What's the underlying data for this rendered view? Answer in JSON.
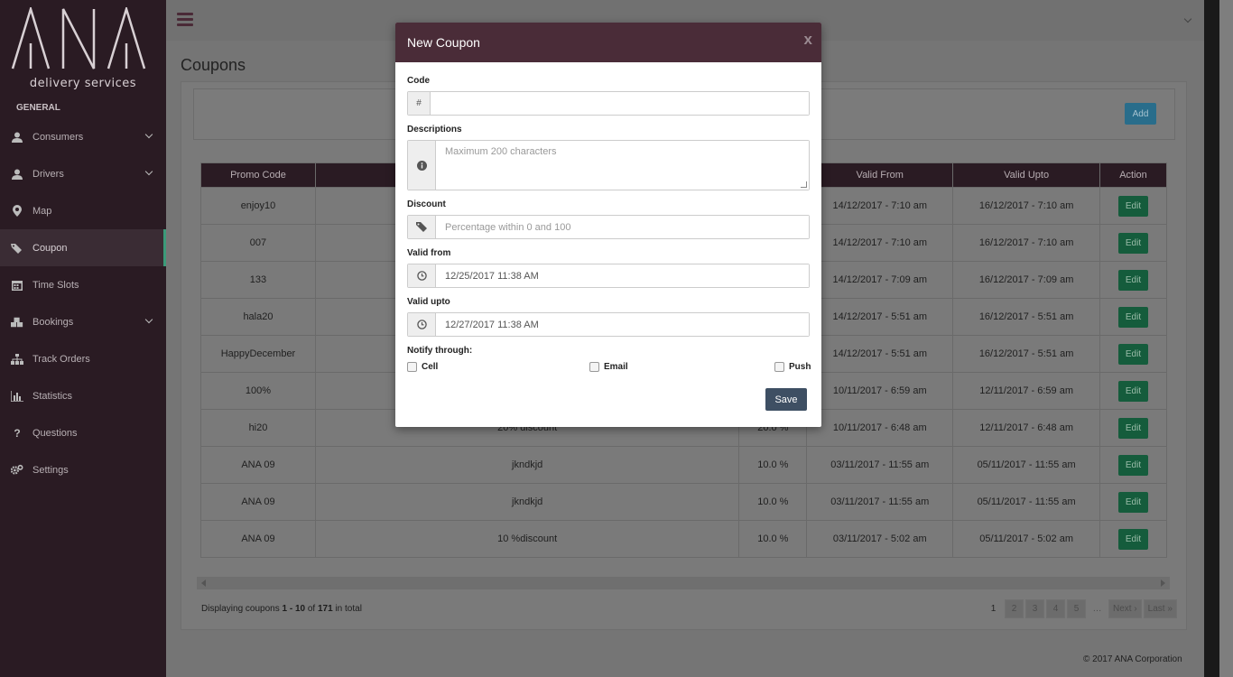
{
  "brand": {
    "logo_text": "ANA",
    "subtitle": "delivery services"
  },
  "sidebar": {
    "section": "GENERAL",
    "items": [
      {
        "label": "Consumers",
        "icon": "user-icon",
        "has_submenu": true
      },
      {
        "label": "Drivers",
        "icon": "user-icon",
        "has_submenu": true
      },
      {
        "label": "Map",
        "icon": "map-marker-icon",
        "has_submenu": false
      },
      {
        "label": "Coupon",
        "icon": "tags-icon",
        "has_submenu": false,
        "active": true
      },
      {
        "label": "Time Slots",
        "icon": "calendar-icon",
        "has_submenu": false
      },
      {
        "label": "Bookings",
        "icon": "cubes-icon",
        "has_submenu": true
      },
      {
        "label": "Track Orders",
        "icon": "sitemap-icon",
        "has_submenu": false
      },
      {
        "label": "Statistics",
        "icon": "bar-chart-icon",
        "has_submenu": false
      },
      {
        "label": "Questions",
        "icon": "question-icon",
        "has_submenu": false
      },
      {
        "label": "Settings",
        "icon": "cogs-icon",
        "has_submenu": false
      }
    ]
  },
  "page": {
    "title": "Coupons",
    "add_label": "Add"
  },
  "table": {
    "headers": [
      "Promo Code",
      "",
      "",
      "Valid From",
      "Valid Upto",
      "Action"
    ],
    "rows": [
      {
        "code": "enjoy10",
        "desc": "",
        "discount": "",
        "from": "14/12/2017 - 7:10 am",
        "upto": "16/12/2017 - 7:10 am"
      },
      {
        "code": "007",
        "desc": "",
        "discount": "",
        "from": "14/12/2017 - 7:10 am",
        "upto": "16/12/2017 - 7:10 am"
      },
      {
        "code": "133",
        "desc": "",
        "discount": "",
        "from": "14/12/2017 - 7:09 am",
        "upto": "16/12/2017 - 7:09 am"
      },
      {
        "code": "hala20",
        "desc": "",
        "discount": "",
        "from": "14/12/2017 - 5:51 am",
        "upto": "16/12/2017 - 5:51 am"
      },
      {
        "code": "HappyDecember",
        "desc": "",
        "discount": "",
        "from": "14/12/2017 - 5:51 am",
        "upto": "16/12/2017 - 5:51 am"
      },
      {
        "code": "100%",
        "desc": "",
        "discount": "",
        "from": "10/11/2017 - 6:59 am",
        "upto": "12/11/2017 - 6:59 am"
      },
      {
        "code": "hi20",
        "desc": "20% discount",
        "discount": "20.0 %",
        "from": "10/11/2017 - 6:48 am",
        "upto": "12/11/2017 - 6:48 am"
      },
      {
        "code": "ANA 09",
        "desc": "jkndkjd",
        "discount": "10.0 %",
        "from": "03/11/2017 - 11:55 am",
        "upto": "05/11/2017 - 11:55 am"
      },
      {
        "code": "ANA 09",
        "desc": "jkndkjd",
        "discount": "10.0 %",
        "from": "03/11/2017 - 11:55 am",
        "upto": "05/11/2017 - 11:55 am"
      },
      {
        "code": "ANA 09",
        "desc": "10 %discount",
        "discount": "10.0 %",
        "from": "03/11/2017 - 5:02 am",
        "upto": "05/11/2017 - 5:02 am"
      }
    ],
    "edit_label": "Edit"
  },
  "pagination": {
    "display_prefix": "Displaying coupons ",
    "range": "1 - 10",
    "of_text": " of ",
    "total": "171",
    "suffix": " in total",
    "pages": [
      "1",
      "2",
      "3",
      "4",
      "5"
    ],
    "ellipsis": "…",
    "next": "Next ›",
    "last": "Last »"
  },
  "footer": {
    "copyright": "© 2017 ANA Corporation"
  },
  "modal": {
    "title": "New Coupon",
    "close": "x",
    "code": {
      "label": "Code",
      "addon": "#",
      "value": "",
      "placeholder": ""
    },
    "descriptions": {
      "label": "Descriptions",
      "placeholder": "Maximum 200 characters",
      "icon": "info-circle-icon"
    },
    "discount": {
      "label": "Discount",
      "placeholder": "Percentage within 0 and 100",
      "icon": "tag-icon"
    },
    "valid_from": {
      "label": "Valid from",
      "value": "12/25/2017 11:38 AM",
      "icon": "clock-icon"
    },
    "valid_upto": {
      "label": "Valid upto",
      "value": "12/27/2017 11:38 AM",
      "icon": "clock-icon"
    },
    "notify": {
      "label": "Notify through:",
      "options": [
        {
          "label": "Cell",
          "checked": false
        },
        {
          "label": "Email",
          "checked": false
        },
        {
          "label": "Push",
          "checked": false
        }
      ]
    },
    "save_label": "Save"
  },
  "colors": {
    "sidebar_bg": "#2a1b23",
    "modal_header": "#4a2c38",
    "active_accent": "#3b9a79",
    "save_btn": "#3e4f63",
    "edit_btn": "#155c3c"
  }
}
